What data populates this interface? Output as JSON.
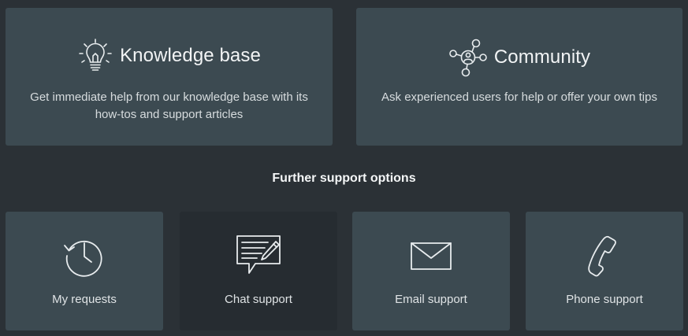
{
  "top_cards": {
    "knowledge_base": {
      "title": "Knowledge base",
      "description": "Get immediate help from our knowledge base with its how-tos and support articles",
      "icon": "lightbulb-icon"
    },
    "community": {
      "title": "Community",
      "description": "Ask experienced users for help or offer your own tips",
      "icon": "community-network-icon"
    }
  },
  "further": {
    "heading": "Further support options",
    "items": [
      {
        "label": "My requests",
        "icon": "history-clock-icon"
      },
      {
        "label": "Chat support",
        "icon": "chat-edit-icon"
      },
      {
        "label": "Email support",
        "icon": "envelope-icon"
      },
      {
        "label": "Phone support",
        "icon": "phone-icon"
      }
    ]
  },
  "colors": {
    "background": "#2b3136",
    "card": "#3c4a51",
    "card_active": "#262c31",
    "text": "#e6eaec"
  }
}
